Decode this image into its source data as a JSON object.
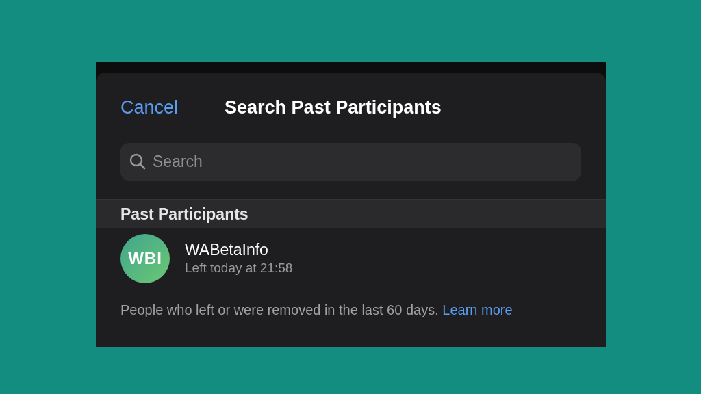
{
  "sheet": {
    "cancel": "Cancel",
    "title": "Search Past Participants"
  },
  "search": {
    "placeholder": "Search"
  },
  "section": {
    "title": "Past Participants"
  },
  "participants": [
    {
      "avatar": "WBI",
      "name": "WABetaInfo",
      "status": "Left today at 21:58"
    }
  ],
  "footer": {
    "text": "People who left or were removed in the last 60 days.",
    "link": "Learn more"
  }
}
